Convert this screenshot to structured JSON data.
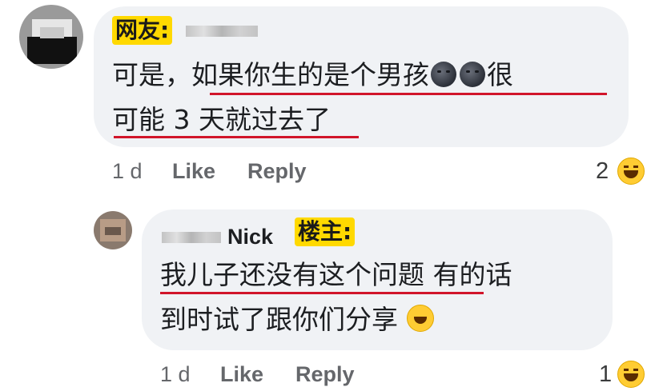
{
  "comment1": {
    "tag": "网友:",
    "line1_a": "可是，",
    "line1_b": "如果你生的是个男孩",
    "line1_c": "很",
    "line2": "可能 3 天就过去了",
    "emoji": "new-moon-face",
    "time": "1 d",
    "like": "Like",
    "reply": "Reply",
    "reaction_count": "2",
    "reaction_icon": "laughing-face"
  },
  "comment2": {
    "name": "Nick",
    "tag": "楼主:",
    "line1_a": "我儿子还没有这个问题",
    "line1_b": " 有的话",
    "line2": "到时试了跟你们分享",
    "emoji": "rolling-on-floor-laughing",
    "time": "1 d",
    "like": "Like",
    "reply": "Reply",
    "reaction_count": "1",
    "reaction_icon": "laughing-face"
  },
  "colors": {
    "bubble": "#f0f2f5",
    "underline": "#d1152a",
    "tag_bg": "#ffd900",
    "meta_text": "#65676b"
  }
}
